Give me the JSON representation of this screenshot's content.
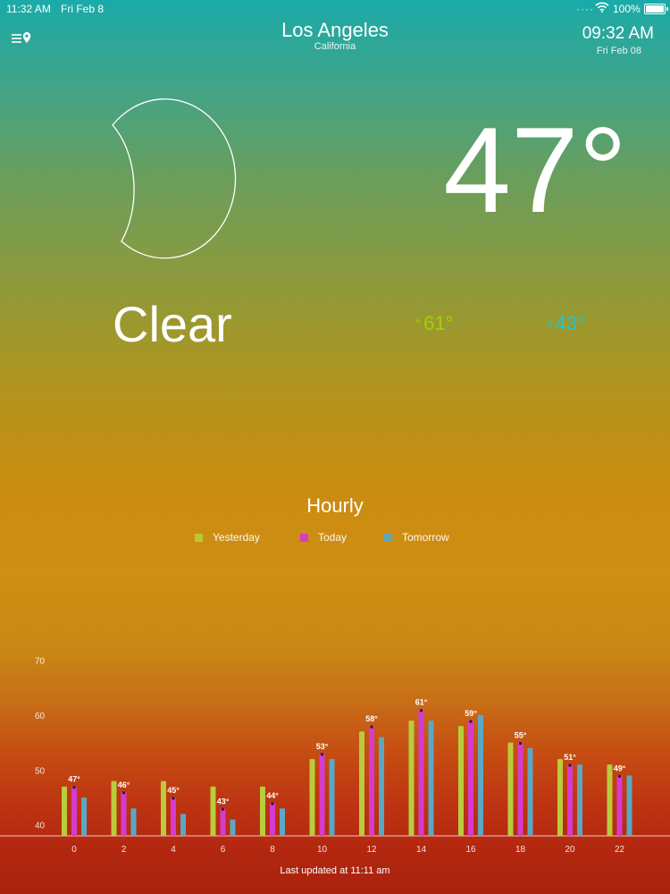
{
  "status_bar": {
    "time": "11:32 AM",
    "date": "Fri Feb 8",
    "dots": "····",
    "battery": "100%"
  },
  "location": {
    "city": "Los Angeles",
    "state": "California",
    "local_time": "09:32 AM",
    "local_date": "Fri Feb 08"
  },
  "icons": {
    "menu": "menu-location-icon",
    "weather": "crescent-moon-icon",
    "high": "chevron-up-icon",
    "low": "chevron-down-icon"
  },
  "current": {
    "temperature": "47°",
    "condition": "Clear",
    "high": "61°",
    "low": "43°"
  },
  "colors": {
    "yesterday": "#b8cc3c",
    "today": "#d63bd0",
    "tomorrow": "#5aa8c4",
    "high": "#9ed400",
    "low": "#25c4d0"
  },
  "hourly": {
    "title": "Hourly",
    "legend": [
      "Yesterday",
      "Today",
      "Tomorrow"
    ]
  },
  "chart_data": {
    "type": "bar",
    "categories": [
      "0",
      "2",
      "4",
      "6",
      "8",
      "10",
      "12",
      "14",
      "16",
      "18",
      "20",
      "22"
    ],
    "series": [
      {
        "name": "Yesterday",
        "values": [
          47,
          48,
          48,
          47,
          47,
          52,
          57,
          59,
          58,
          55,
          52,
          51
        ]
      },
      {
        "name": "Today",
        "values": [
          47,
          46,
          45,
          43,
          44,
          53,
          58,
          61,
          59,
          55,
          51,
          49
        ]
      },
      {
        "name": "Tomorrow",
        "values": [
          45,
          43,
          42,
          41,
          43,
          52,
          56,
          59,
          60,
          54,
          51,
          49
        ]
      }
    ],
    "data_labels": [
      "47°",
      "46°",
      "45°",
      "43°",
      "44°",
      "53°",
      "58°",
      "61°",
      "59°",
      "55°",
      "51°",
      "49°"
    ],
    "yticks": [
      "40",
      "50",
      "60",
      "70"
    ],
    "ylim": [
      38,
      73
    ],
    "legend_position": "top-center",
    "grid": false
  },
  "footer": {
    "updated": "Last updated at 11:11 am"
  }
}
